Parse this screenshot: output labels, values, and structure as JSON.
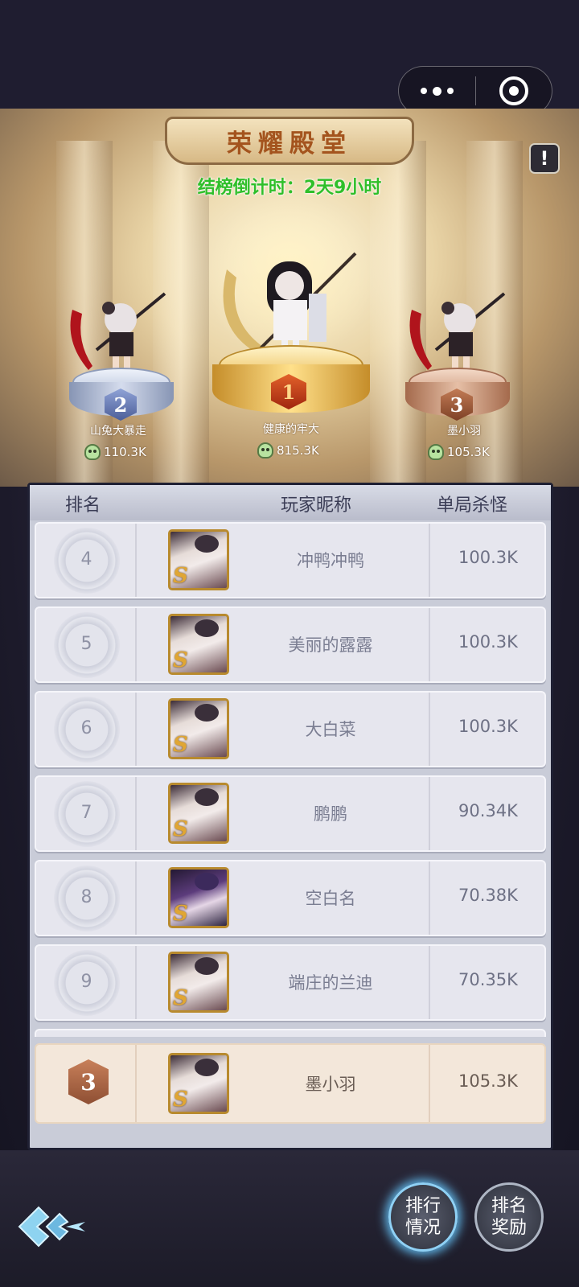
{
  "hall": {
    "title": "荣耀殿堂",
    "countdown": "结榜倒计时：2天9小时",
    "notice_icon": "!"
  },
  "podium": [
    {
      "rank": "2",
      "name": "山兔大暴走",
      "score": "110.3K"
    },
    {
      "rank": "1",
      "name": "健康的牢大",
      "score": "815.3K"
    },
    {
      "rank": "3",
      "name": "墨小羽",
      "score": "105.3K"
    }
  ],
  "table": {
    "headers": {
      "rank": "排名",
      "name": "玩家昵称",
      "score": "单局杀怪"
    },
    "rows": [
      {
        "rank": "4",
        "name": "冲鸭冲鸭",
        "score": "100.3K",
        "avatar": "white-hair"
      },
      {
        "rank": "5",
        "name": "美丽的露露",
        "score": "100.3K",
        "avatar": "white-hair"
      },
      {
        "rank": "6",
        "name": "大白菜",
        "score": "100.3K",
        "avatar": "white-hair"
      },
      {
        "rank": "7",
        "name": "鹏鹏",
        "score": "90.34K",
        "avatar": "white-hair"
      },
      {
        "rank": "8",
        "name": "空白名",
        "score": "70.38K",
        "avatar": "purple-hair"
      },
      {
        "rank": "9",
        "name": "端庄的兰迪",
        "score": "70.35K",
        "avatar": "white-hair"
      }
    ],
    "avatar_mark": "S",
    "mine": {
      "rank": "3",
      "name": "墨小羽",
      "score": "105.3K"
    }
  },
  "buttons": {
    "ranking_status": "排行\n情况",
    "ranking_reward": "排名\n奖励"
  },
  "colors": {
    "countdown": "#2fbf2a",
    "title": "#a4541e",
    "gold": "#d9a640",
    "silver": "#9fb0d0",
    "bronze": "#c08a6a",
    "active_glow": "#5fb4e6"
  }
}
